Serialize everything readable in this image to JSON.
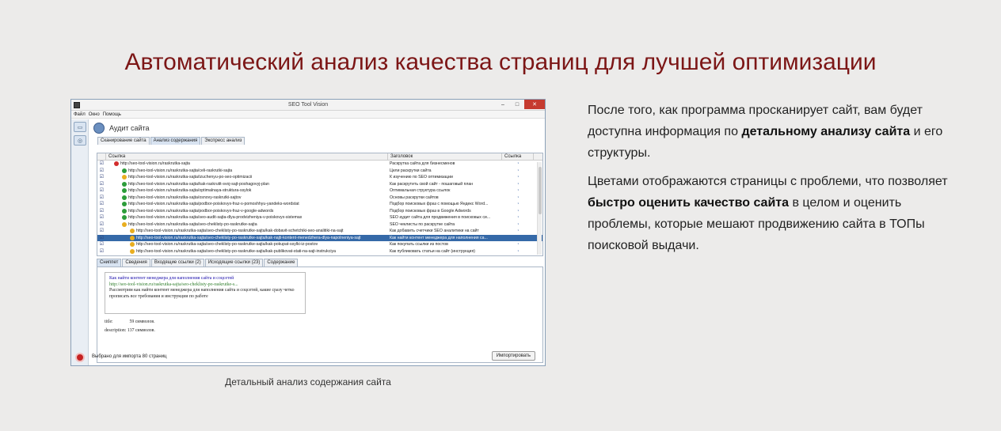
{
  "headline": "Автоматический анализ качества страниц для лучшей оптимизации",
  "caption": "Детальный анализ содержания сайта",
  "right_text": {
    "p1_a": "После того, как программа просканирует сайт, вам будет доступна информация по ",
    "p1_b": "детальному анализу сайта",
    "p1_c": " и его структуры.",
    "p2_a": "Цветами отображаются страницы с проблеми, что позволяет ",
    "p2_b": "быстро оценить качество сайта",
    "p2_c": " в целом и оценить проблемы, которые мешают продвижению сайта в ТОПы поисковой выдачи."
  },
  "window": {
    "title": "SEO Tool Vision",
    "menu": [
      "Файл",
      "Окно",
      "Помощь"
    ],
    "section_title": "Аудит сайта",
    "tabs": [
      "Сканирование сайта",
      "Анализ содержания",
      "Экспресс анализ"
    ],
    "columns": [
      "Ссылка",
      "Заголовок",
      "Ссылка"
    ],
    "rows": [
      {
        "url": "http://seo-tool-vision.ru/raskrutka-sajta",
        "title": "Раскрутка сайта для бизнесменов",
        "status": "err"
      },
      {
        "url": "http://seo-tool-vision.ru/raskrutka-sajta/celi-raskrutki-sajta",
        "title": "Цели раскрутки сайта",
        "status": "ok"
      },
      {
        "url": "http://seo-tool-vision.ru/raskrutka-sajta/izuchenyu-po-seo-optimizacii",
        "title": "К изучению по SEO оптимизации",
        "status": "warn"
      },
      {
        "url": "http://seo-tool-vision.ru/raskrutka-sajta/kak-raskrutit-svoj-sajt-poshagovyj-plan",
        "title": "Как раскрутить свой сайт - пошаговый план",
        "status": "ok"
      },
      {
        "url": "http://seo-tool-vision.ru/raskrutka-sajta/optimalnaya-struktura-ssylok",
        "title": "Оптимальная структура ссылок",
        "status": "ok"
      },
      {
        "url": "http://seo-tool-vision.ru/raskrutka-sajta/osnovy-raskrutki-sajtov",
        "title": "Основы раскрутки сайтов",
        "status": "ok"
      },
      {
        "url": "http://seo-tool-vision.ru/raskrutka-sajta/podbor-poiskovyx-fraz-s-pomoshhyu-yandeks-wordstat",
        "title": "Подбор поисковых фраз с помощью Яндекс Word...",
        "status": "ok"
      },
      {
        "url": "http://seo-tool-vision.ru/raskrutka-sajta/podbor-poiskovyx-fraz-v-google-adwords",
        "title": "Подбор поисковых фраз в Google Adwords",
        "status": "ok"
      },
      {
        "url": "http://seo-tool-vision.ru/raskrutka-sajta/seo-audit-sajta-dlya-prodvizheniya-v-poiskovyx-sistemax",
        "title": "SEO аудит сайта для продвижения в поисковых си...",
        "status": "ok"
      },
      {
        "url": "http://seo-tool-vision.ru/raskrutka-sajta/seo-cheklisty-po-raskrutke-sajta",
        "title": "SEO чеклисты по раскрутке сайта",
        "status": "warn"
      },
      {
        "url": "http://seo-tool-vision.ru/raskrutka-sajta/seo-cheklisty-po-raskrutke-sajta/kak-dobavit-schetchiki-seo-analitiki-na-sajt",
        "title": "Как добавить счетчики SEO аналитики на сайт",
        "status": "warn"
      },
      {
        "url": "http://seo-tool-vision.ru/raskrutka-sajta/seo-cheklisty-po-raskrutke-sajta/kak-najti-kontent-menedzhera-dlya-napolneniya-sajt",
        "title": "Как найти контент менеджера для наполнения са...",
        "status": "warn",
        "selected": true
      },
      {
        "url": "http://seo-tool-vision.ru/raskrutka-sajta/seo-cheklisty-po-raskrutke-sajta/kak-pokupat-ssylki-iz-postov",
        "title": "Как покупать ссылки из постов",
        "status": "warn"
      },
      {
        "url": "http://seo-tool-vision.ru/raskrutka-sajta/seo-cheklisty-po-raskrutke-sajta/kak-publikovat-stati-na-sajt-instrukciya",
        "title": "Как публиковать статьи на сайт (инструкция)",
        "status": "warn"
      }
    ],
    "detail_tabs": [
      "Сниппет",
      "Сведения",
      "Входящие ссылки (2)",
      "Исходящие ссылки (23)",
      "Содержание"
    ],
    "snippet": {
      "title": "Как найти контент менеджера для наполнения сайта и соцсетей",
      "url": "http://seo-tool-vision.ru/raskrutka-sajta/seo-cheklisty-po-raskrutke-s...",
      "desc": "Рассмотрим как найти контент менеджера для наполнения сайта и соцсетей, какие сразу четко прописать все требования и инструкции по работе"
    },
    "meta": {
      "title_label": "title:",
      "title_value": "59 символов.",
      "desc_label": "description:",
      "desc_value": "137 символов."
    },
    "status": "Выбрано для импорта 80 страниц",
    "import_label": "Импортировать",
    "colors": {
      "error": "#d22d2d",
      "warning": "#e9ae1f",
      "ok": "#2c9d3a",
      "selection": "#3569a8"
    }
  }
}
